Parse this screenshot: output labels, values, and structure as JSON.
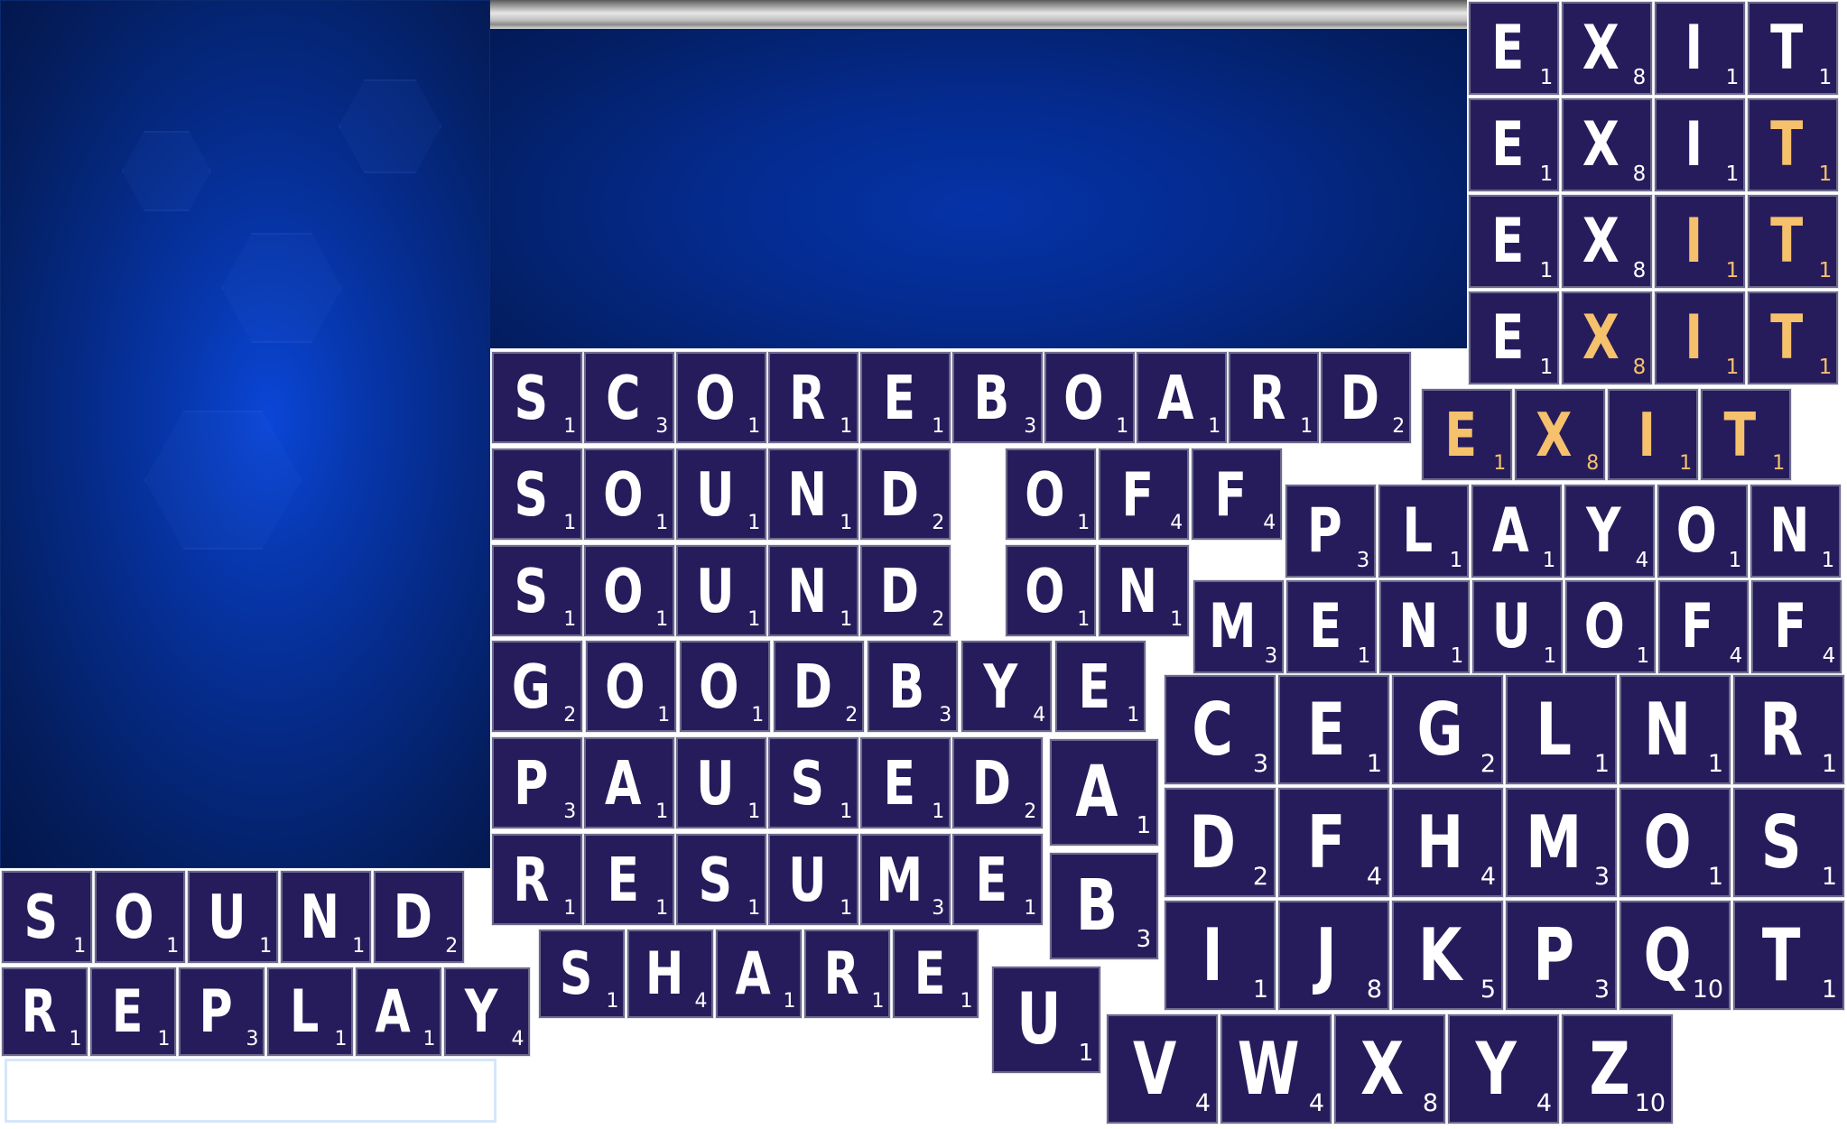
{
  "colors": {
    "tile_bg": "#271c5b",
    "tile_text": "#ffffff",
    "highlight": "#f5c16c",
    "panel_blue": "#0a46d6"
  },
  "exit_rows": [
    {
      "tiles": [
        {
          "l": "E",
          "p": "1",
          "h": false
        },
        {
          "l": "X",
          "p": "8",
          "h": false
        },
        {
          "l": "I",
          "p": "1",
          "h": false
        },
        {
          "l": "T",
          "p": "1",
          "h": false
        }
      ]
    },
    {
      "tiles": [
        {
          "l": "E",
          "p": "1",
          "h": false
        },
        {
          "l": "X",
          "p": "8",
          "h": false
        },
        {
          "l": "I",
          "p": "1",
          "h": false
        },
        {
          "l": "T",
          "p": "1",
          "h": true
        }
      ]
    },
    {
      "tiles": [
        {
          "l": "E",
          "p": "1",
          "h": false
        },
        {
          "l": "X",
          "p": "8",
          "h": false
        },
        {
          "l": "I",
          "p": "1",
          "h": true
        },
        {
          "l": "T",
          "p": "1",
          "h": true
        }
      ]
    },
    {
      "tiles": [
        {
          "l": "E",
          "p": "1",
          "h": false
        },
        {
          "l": "X",
          "p": "8",
          "h": true
        },
        {
          "l": "I",
          "p": "1",
          "h": true
        },
        {
          "l": "T",
          "p": "1",
          "h": true
        }
      ]
    },
    {
      "tiles": [
        {
          "l": "E",
          "p": "1",
          "h": true
        },
        {
          "l": "X",
          "p": "8",
          "h": true
        },
        {
          "l": "I",
          "p": "1",
          "h": true
        },
        {
          "l": "T",
          "p": "1",
          "h": true
        }
      ]
    }
  ],
  "words": {
    "scoreboard": [
      [
        "S",
        "1"
      ],
      [
        "C",
        "3"
      ],
      [
        "O",
        "1"
      ],
      [
        "R",
        "1"
      ],
      [
        "E",
        "1"
      ],
      [
        "B",
        "3"
      ],
      [
        "O",
        "1"
      ],
      [
        "A",
        "1"
      ],
      [
        "R",
        "1"
      ],
      [
        "D",
        "2"
      ]
    ],
    "sound_off_sound": [
      [
        "S",
        "1"
      ],
      [
        "O",
        "1"
      ],
      [
        "U",
        "1"
      ],
      [
        "N",
        "1"
      ],
      [
        "D",
        "2"
      ]
    ],
    "off": [
      [
        "O",
        "1"
      ],
      [
        "F",
        "4"
      ],
      [
        "F",
        "4"
      ]
    ],
    "play_on": [
      [
        "P",
        "3"
      ],
      [
        "L",
        "1"
      ],
      [
        "A",
        "1"
      ],
      [
        "Y",
        "4"
      ],
      [
        "O",
        "1"
      ],
      [
        "N",
        "1"
      ]
    ],
    "sound_on_sound": [
      [
        "S",
        "1"
      ],
      [
        "O",
        "1"
      ],
      [
        "U",
        "1"
      ],
      [
        "N",
        "1"
      ],
      [
        "D",
        "2"
      ]
    ],
    "on": [
      [
        "O",
        "1"
      ],
      [
        "N",
        "1"
      ]
    ],
    "menu_off": [
      [
        "M",
        "3"
      ],
      [
        "E",
        "1"
      ],
      [
        "N",
        "1"
      ],
      [
        "U",
        "1"
      ],
      [
        "O",
        "1"
      ],
      [
        "F",
        "4"
      ],
      [
        "F",
        "4"
      ]
    ],
    "goodbye": [
      [
        "G",
        "2"
      ],
      [
        "O",
        "1"
      ],
      [
        "O",
        "1"
      ],
      [
        "D",
        "2"
      ],
      [
        "B",
        "3"
      ],
      [
        "Y",
        "4"
      ],
      [
        "E",
        "1"
      ]
    ],
    "paused": [
      [
        "P",
        "3"
      ],
      [
        "A",
        "1"
      ],
      [
        "U",
        "1"
      ],
      [
        "S",
        "1"
      ],
      [
        "E",
        "1"
      ],
      [
        "D",
        "2"
      ]
    ],
    "resume": [
      [
        "R",
        "1"
      ],
      [
        "E",
        "1"
      ],
      [
        "S",
        "1"
      ],
      [
        "U",
        "1"
      ],
      [
        "M",
        "3"
      ],
      [
        "E",
        "1"
      ]
    ],
    "share": [
      [
        "S",
        "1"
      ],
      [
        "H",
        "4"
      ],
      [
        "A",
        "1"
      ],
      [
        "R",
        "1"
      ],
      [
        "E",
        "1"
      ]
    ],
    "sound": [
      [
        "S",
        "1"
      ],
      [
        "O",
        "1"
      ],
      [
        "U",
        "1"
      ],
      [
        "N",
        "1"
      ],
      [
        "D",
        "2"
      ]
    ],
    "replay": [
      [
        "R",
        "1"
      ],
      [
        "E",
        "1"
      ],
      [
        "P",
        "3"
      ],
      [
        "L",
        "1"
      ],
      [
        "A",
        "1"
      ],
      [
        "Y",
        "4"
      ]
    ]
  },
  "singles": {
    "a": [
      "A",
      "1"
    ],
    "b": [
      "B",
      "3"
    ],
    "u": [
      "U",
      "1"
    ]
  },
  "alphabet_rows": [
    [
      [
        "C",
        "3"
      ],
      [
        "E",
        "1"
      ],
      [
        "G",
        "2"
      ],
      [
        "L",
        "1"
      ],
      [
        "N",
        "1"
      ],
      [
        "R",
        "1"
      ]
    ],
    [
      [
        "D",
        "2"
      ],
      [
        "F",
        "4"
      ],
      [
        "H",
        "4"
      ],
      [
        "M",
        "3"
      ],
      [
        "O",
        "1"
      ],
      [
        "S",
        "1"
      ]
    ],
    [
      [
        "I",
        "1"
      ],
      [
        "J",
        "8"
      ],
      [
        "K",
        "5"
      ],
      [
        "P",
        "3"
      ],
      [
        "Q",
        "10"
      ],
      [
        "T",
        "1"
      ]
    ],
    [
      [
        "V",
        "4"
      ],
      [
        "W",
        "4"
      ],
      [
        "X",
        "8"
      ],
      [
        "Y",
        "4"
      ],
      [
        "Z",
        "10"
      ]
    ]
  ],
  "input_box": {
    "value": ""
  }
}
